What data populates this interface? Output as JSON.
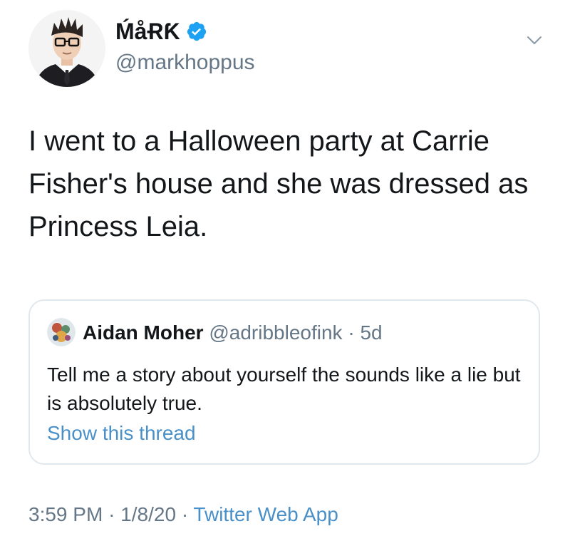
{
  "author": {
    "display_name": "ḾåɌƘ",
    "handle": "@markhoppus",
    "verified": true
  },
  "tweet": {
    "text": "I went to a Halloween party at Carrie Fisher's house and she was dressed as Princess Leia."
  },
  "quoted_tweet": {
    "name": "Aidan Moher",
    "handle": "@adribbleofink",
    "separator": "·",
    "age": "5d",
    "text": "Tell me a story about yourself the sounds like a lie but is absolutely true.",
    "show_thread_label": "Show this thread"
  },
  "meta": {
    "time": "3:59 PM",
    "sep1": "·",
    "date": "1/8/20",
    "sep2": "·",
    "source": "Twitter Web App"
  },
  "colors": {
    "accent": "#1da1f2",
    "link": "#4a90c8",
    "secondary_text": "#657786",
    "border": "#e1e8ed"
  }
}
